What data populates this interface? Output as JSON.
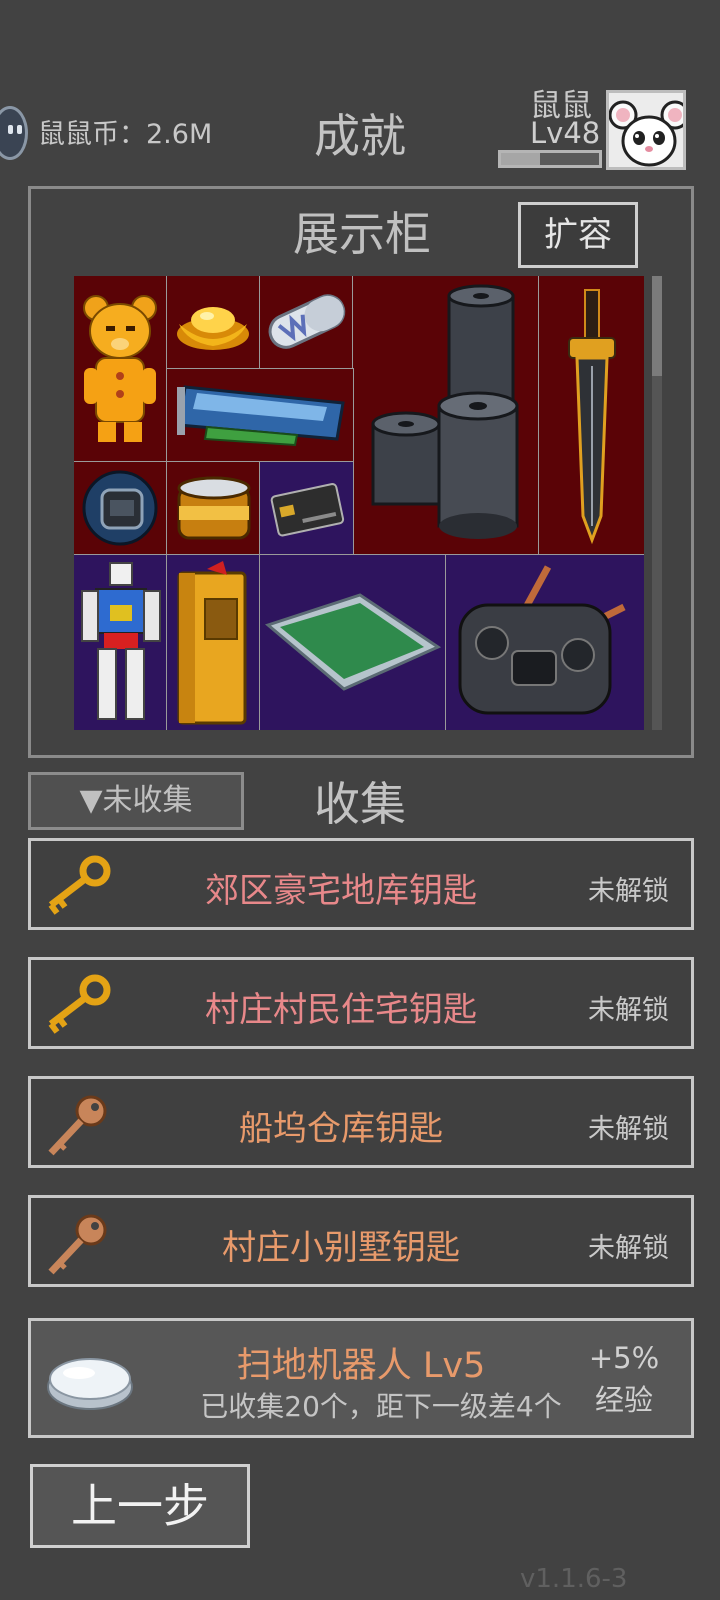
{
  "header": {
    "currency": "鼠鼠币：2.6M",
    "title": "成就",
    "player_name": "鼠鼠",
    "player_level": "Lv48",
    "exp_fraction": 0.4,
    "coin_icon": "coin-icon",
    "avatar": "mouse-avatar"
  },
  "showcase": {
    "title": "展示柜",
    "expand_label": "扩容",
    "items": [
      {
        "icon": "teddy-bear-figure-icon",
        "color": "red"
      },
      {
        "icon": "gold-ingot-icon",
        "color": "red"
      },
      {
        "icon": "vitamin-capsule-icon",
        "color": "red"
      },
      {
        "icon": "graphics-card-icon",
        "color": "red"
      },
      {
        "icon": "film-rolls-icon",
        "color": "red"
      },
      {
        "icon": "sword-icon",
        "color": "red"
      },
      {
        "icon": "smart-watch-icon",
        "color": "red"
      },
      {
        "icon": "gold-jar-icon",
        "color": "red"
      },
      {
        "icon": "bank-cards-icon",
        "color": "blue"
      },
      {
        "icon": "robot-figure-icon",
        "color": "blue"
      },
      {
        "icon": "gold-book-icon",
        "color": "blue"
      },
      {
        "icon": "glass-tray-icon",
        "color": "blue"
      },
      {
        "icon": "remote-controller-icon",
        "color": "blue"
      }
    ],
    "colors": {
      "red": "#5a0306",
      "blue": "#2e145e"
    }
  },
  "collection": {
    "filter_label": "▼未收集",
    "title": "收集",
    "keys": [
      {
        "name": "郊区豪宅地库钥匙",
        "status": "未解锁",
        "color": "#e8888a",
        "icon": "gold-key-icon"
      },
      {
        "name": "村庄村民住宅钥匙",
        "status": "未解锁",
        "color": "#e8888a",
        "icon": "gold-key-icon"
      },
      {
        "name": "船坞仓库钥匙",
        "status": "未解锁",
        "color": "#e89a6b",
        "icon": "bronze-key-icon"
      },
      {
        "name": "村庄小别墅钥匙",
        "status": "未解锁",
        "color": "#e89a6b",
        "icon": "bronze-key-icon"
      }
    ],
    "bonus": {
      "name": "扫地机器人  Lv5",
      "progress": "已收集20个，距下一级差4个",
      "value_line1": "+5%",
      "value_line2": "经验",
      "icon": "robot-vacuum-icon"
    }
  },
  "footer": {
    "back_label": "上一步",
    "version": "v1.1.6-3"
  }
}
